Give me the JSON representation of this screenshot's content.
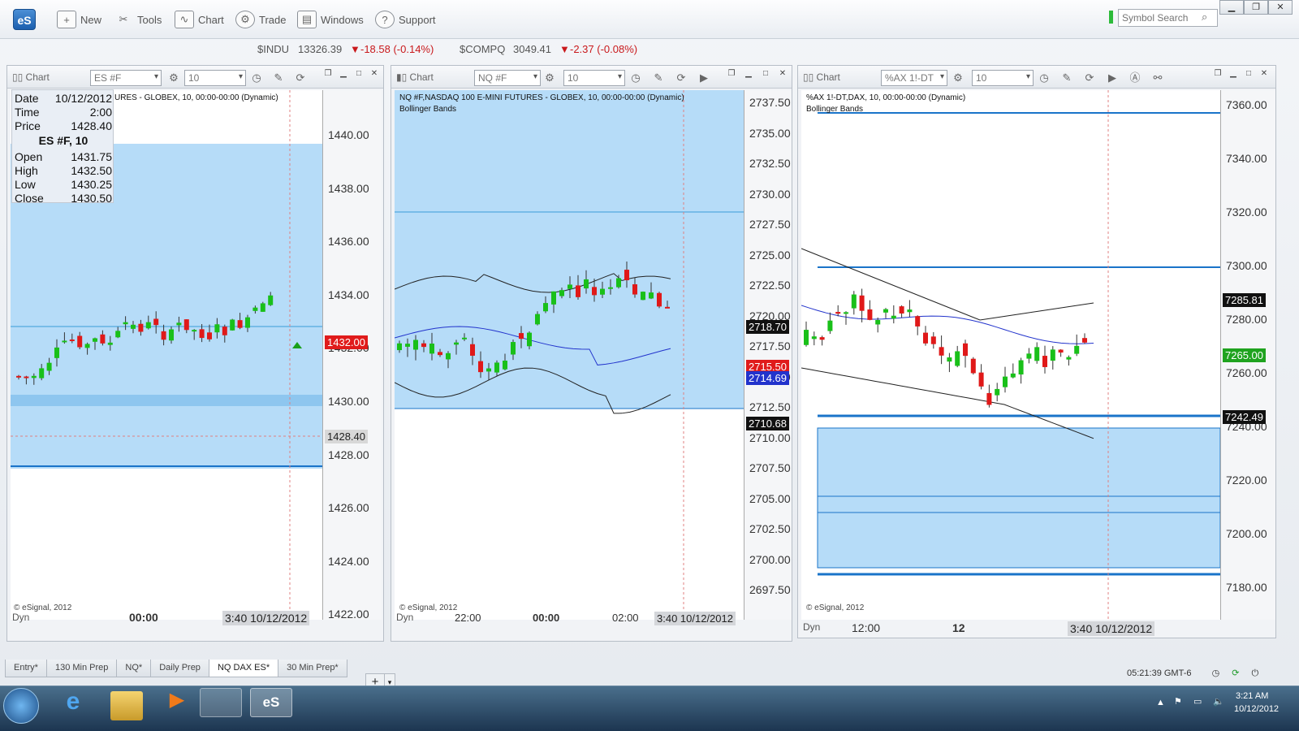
{
  "app": {
    "logo": "eS"
  },
  "toolbar": {
    "new_label": "New",
    "tools_label": "Tools",
    "chart_label": "Chart",
    "trade_label": "Trade",
    "windows_label": "Windows",
    "support_label": "Support",
    "search_placeholder": "Symbol Search"
  },
  "ticker": {
    "indu_sym": "$INDU",
    "indu_price": "13326.39",
    "indu_change": "-18.58 (-0.14%)",
    "compq_sym": "$COMPQ",
    "compq_price": "3049.41",
    "compq_change": "-2.37 (-0.08%)"
  },
  "charts": [
    {
      "label": "Chart",
      "symbol": "ES #F",
      "interval": "10",
      "title": "URES - GLOBEX, 10, 00:00-00:00 (Dynamic)",
      "yticks": [
        "1440.00",
        "1438.00",
        "1436.00",
        "1434.00",
        "1432.00",
        "1430.00",
        "1428.00",
        "1426.00",
        "1424.00",
        "1422.00"
      ],
      "price_labels": [
        {
          "text": "1432.00",
          "color": "#e01b1b"
        },
        {
          "text": "1428.40",
          "color": "#d8d8d8"
        }
      ],
      "x_labels": [
        "00:00"
      ],
      "time_label": "3:40 10/12/2012",
      "copyright": "© eSignal, 2012",
      "dyn": "Dyn"
    },
    {
      "label": "Chart",
      "symbol": "NQ #F",
      "interval": "10",
      "title": "NQ #F,NASDAQ 100 E-MINI FUTURES - GLOBEX, 10, 00:00-00:00 (Dynamic)",
      "subtitle": "Bollinger Bands",
      "yticks": [
        "2737.50",
        "2735.00",
        "2732.50",
        "2730.00",
        "2727.50",
        "2725.00",
        "2722.50",
        "2720.00",
        "2717.50",
        "2715.00",
        "2712.50",
        "2710.00",
        "2707.50",
        "2705.00",
        "2702.50",
        "2700.00",
        "2697.50"
      ],
      "price_labels": [
        {
          "text": "2718.70",
          "color": "#111"
        },
        {
          "text": "2715.50",
          "color": "#e01b1b"
        },
        {
          "text": "2714.69",
          "color": "#2233cc"
        },
        {
          "text": "2710.68",
          "color": "#111"
        }
      ],
      "x_labels": [
        "22:00",
        "00:00",
        "02:00"
      ],
      "time_label": "3:40 10/12/2012",
      "copyright": "© eSignal, 2012",
      "dyn": "Dyn"
    },
    {
      "label": "Chart",
      "symbol": "%AX 1!-DT",
      "interval": "10",
      "title": "%AX 1!-DT,DAX, 10, 00:00-00:00 (Dynamic)",
      "subtitle": "Bollinger Bands",
      "yticks": [
        "7360.00",
        "7340.00",
        "7320.00",
        "7300.00",
        "7280.00",
        "7260.00",
        "7240.00",
        "7220.00",
        "7200.00",
        "7180.00"
      ],
      "price_labels": [
        {
          "text": "7285.81",
          "color": "#111"
        },
        {
          "text": "7265.00",
          "color": "#1fa31f"
        },
        {
          "text": "7242.49",
          "color": "#111"
        }
      ],
      "x_labels": [
        "12:00",
        "12"
      ],
      "time_label": "3:40 10/12/2012",
      "copyright": "© eSignal, 2012",
      "dyn": "Dyn"
    }
  ],
  "databox": {
    "date_k": "Date",
    "date_v": "10/12/2012",
    "time_k": "Time",
    "time_v": "2:00",
    "price_k": "Price",
    "price_v": "1428.40",
    "header": "ES #F, 10",
    "open_k": "Open",
    "open_v": "1431.75",
    "high_k": "High",
    "high_v": "1432.50",
    "low_k": "Low",
    "low_v": "1430.25",
    "close_k": "Close",
    "close_v": "1430.50"
  },
  "tabs": [
    "Entry*",
    "130 Min Prep",
    "NQ*",
    "Daily Prep",
    "NQ DAX ES*",
    "30 Min Prep*"
  ],
  "active_tab": "NQ DAX ES*",
  "status": {
    "clock": "05:21:39 GMT-6"
  },
  "taskbar": {
    "time": "3:21 AM",
    "date": "10/12/2012"
  }
}
